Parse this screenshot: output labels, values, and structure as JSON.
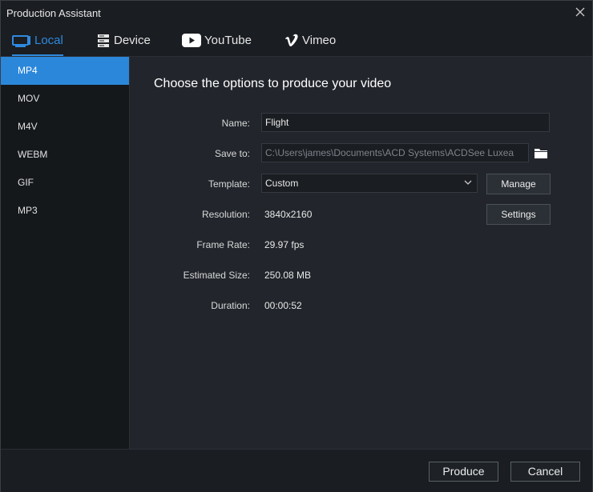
{
  "window": {
    "title": "Production Assistant",
    "accent_color": "#2f8ae0",
    "selection_color": "#2b87da"
  },
  "tabs": [
    {
      "label": "Local",
      "icon": "monitor-icon",
      "active": true
    },
    {
      "label": "Device",
      "icon": "device-icon",
      "active": false
    },
    {
      "label": "YouTube",
      "icon": "youtube-icon",
      "active": false
    },
    {
      "label": "Vimeo",
      "icon": "vimeo-icon",
      "active": false
    }
  ],
  "formats": [
    {
      "label": "MP4",
      "selected": true
    },
    {
      "label": "MOV",
      "selected": false
    },
    {
      "label": "M4V",
      "selected": false
    },
    {
      "label": "WEBM",
      "selected": false
    },
    {
      "label": "GIF",
      "selected": false
    },
    {
      "label": "MP3",
      "selected": false
    }
  ],
  "main": {
    "heading": "Choose the options to produce your video",
    "name_label": "Name:",
    "name_value": "Flight",
    "save_to_label": "Save to:",
    "save_to_value": "C:\\Users\\james\\Documents\\ACD Systems\\ACDSee Luxea",
    "template_label": "Template:",
    "template_value": "Custom",
    "manage_label": "Manage",
    "resolution_label": "Resolution:",
    "resolution_value": "3840x2160",
    "settings_label": "Settings",
    "frame_rate_label": "Frame Rate:",
    "frame_rate_value": "29.97 fps",
    "size_label": "Estimated Size:",
    "size_value": "250.08 MB",
    "duration_label": "Duration:",
    "duration_value": "00:00:52"
  },
  "footer": {
    "produce_label": "Produce",
    "cancel_label": "Cancel"
  }
}
